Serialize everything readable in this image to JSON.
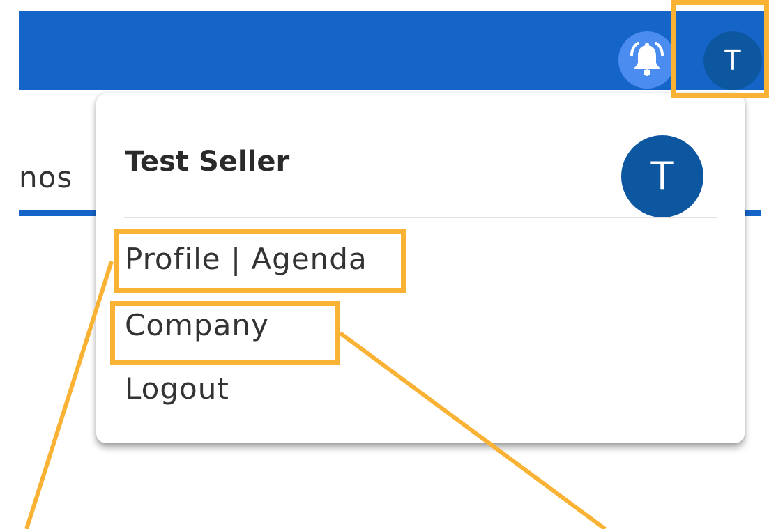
{
  "header": {
    "user_initial": "T",
    "notifications_icon": "bell-icon"
  },
  "background": {
    "tab_fragment": "nos"
  },
  "user_menu": {
    "name": "Test Seller",
    "avatar_initial": "T",
    "items": [
      {
        "label": "Profile | Agenda"
      },
      {
        "label": "Company"
      },
      {
        "label": "Logout"
      }
    ]
  },
  "colors": {
    "topbar": "#1565c9",
    "avatar": "#0d57a0",
    "bell_button": "#4a8cf0",
    "annotation": "#f9b233"
  }
}
